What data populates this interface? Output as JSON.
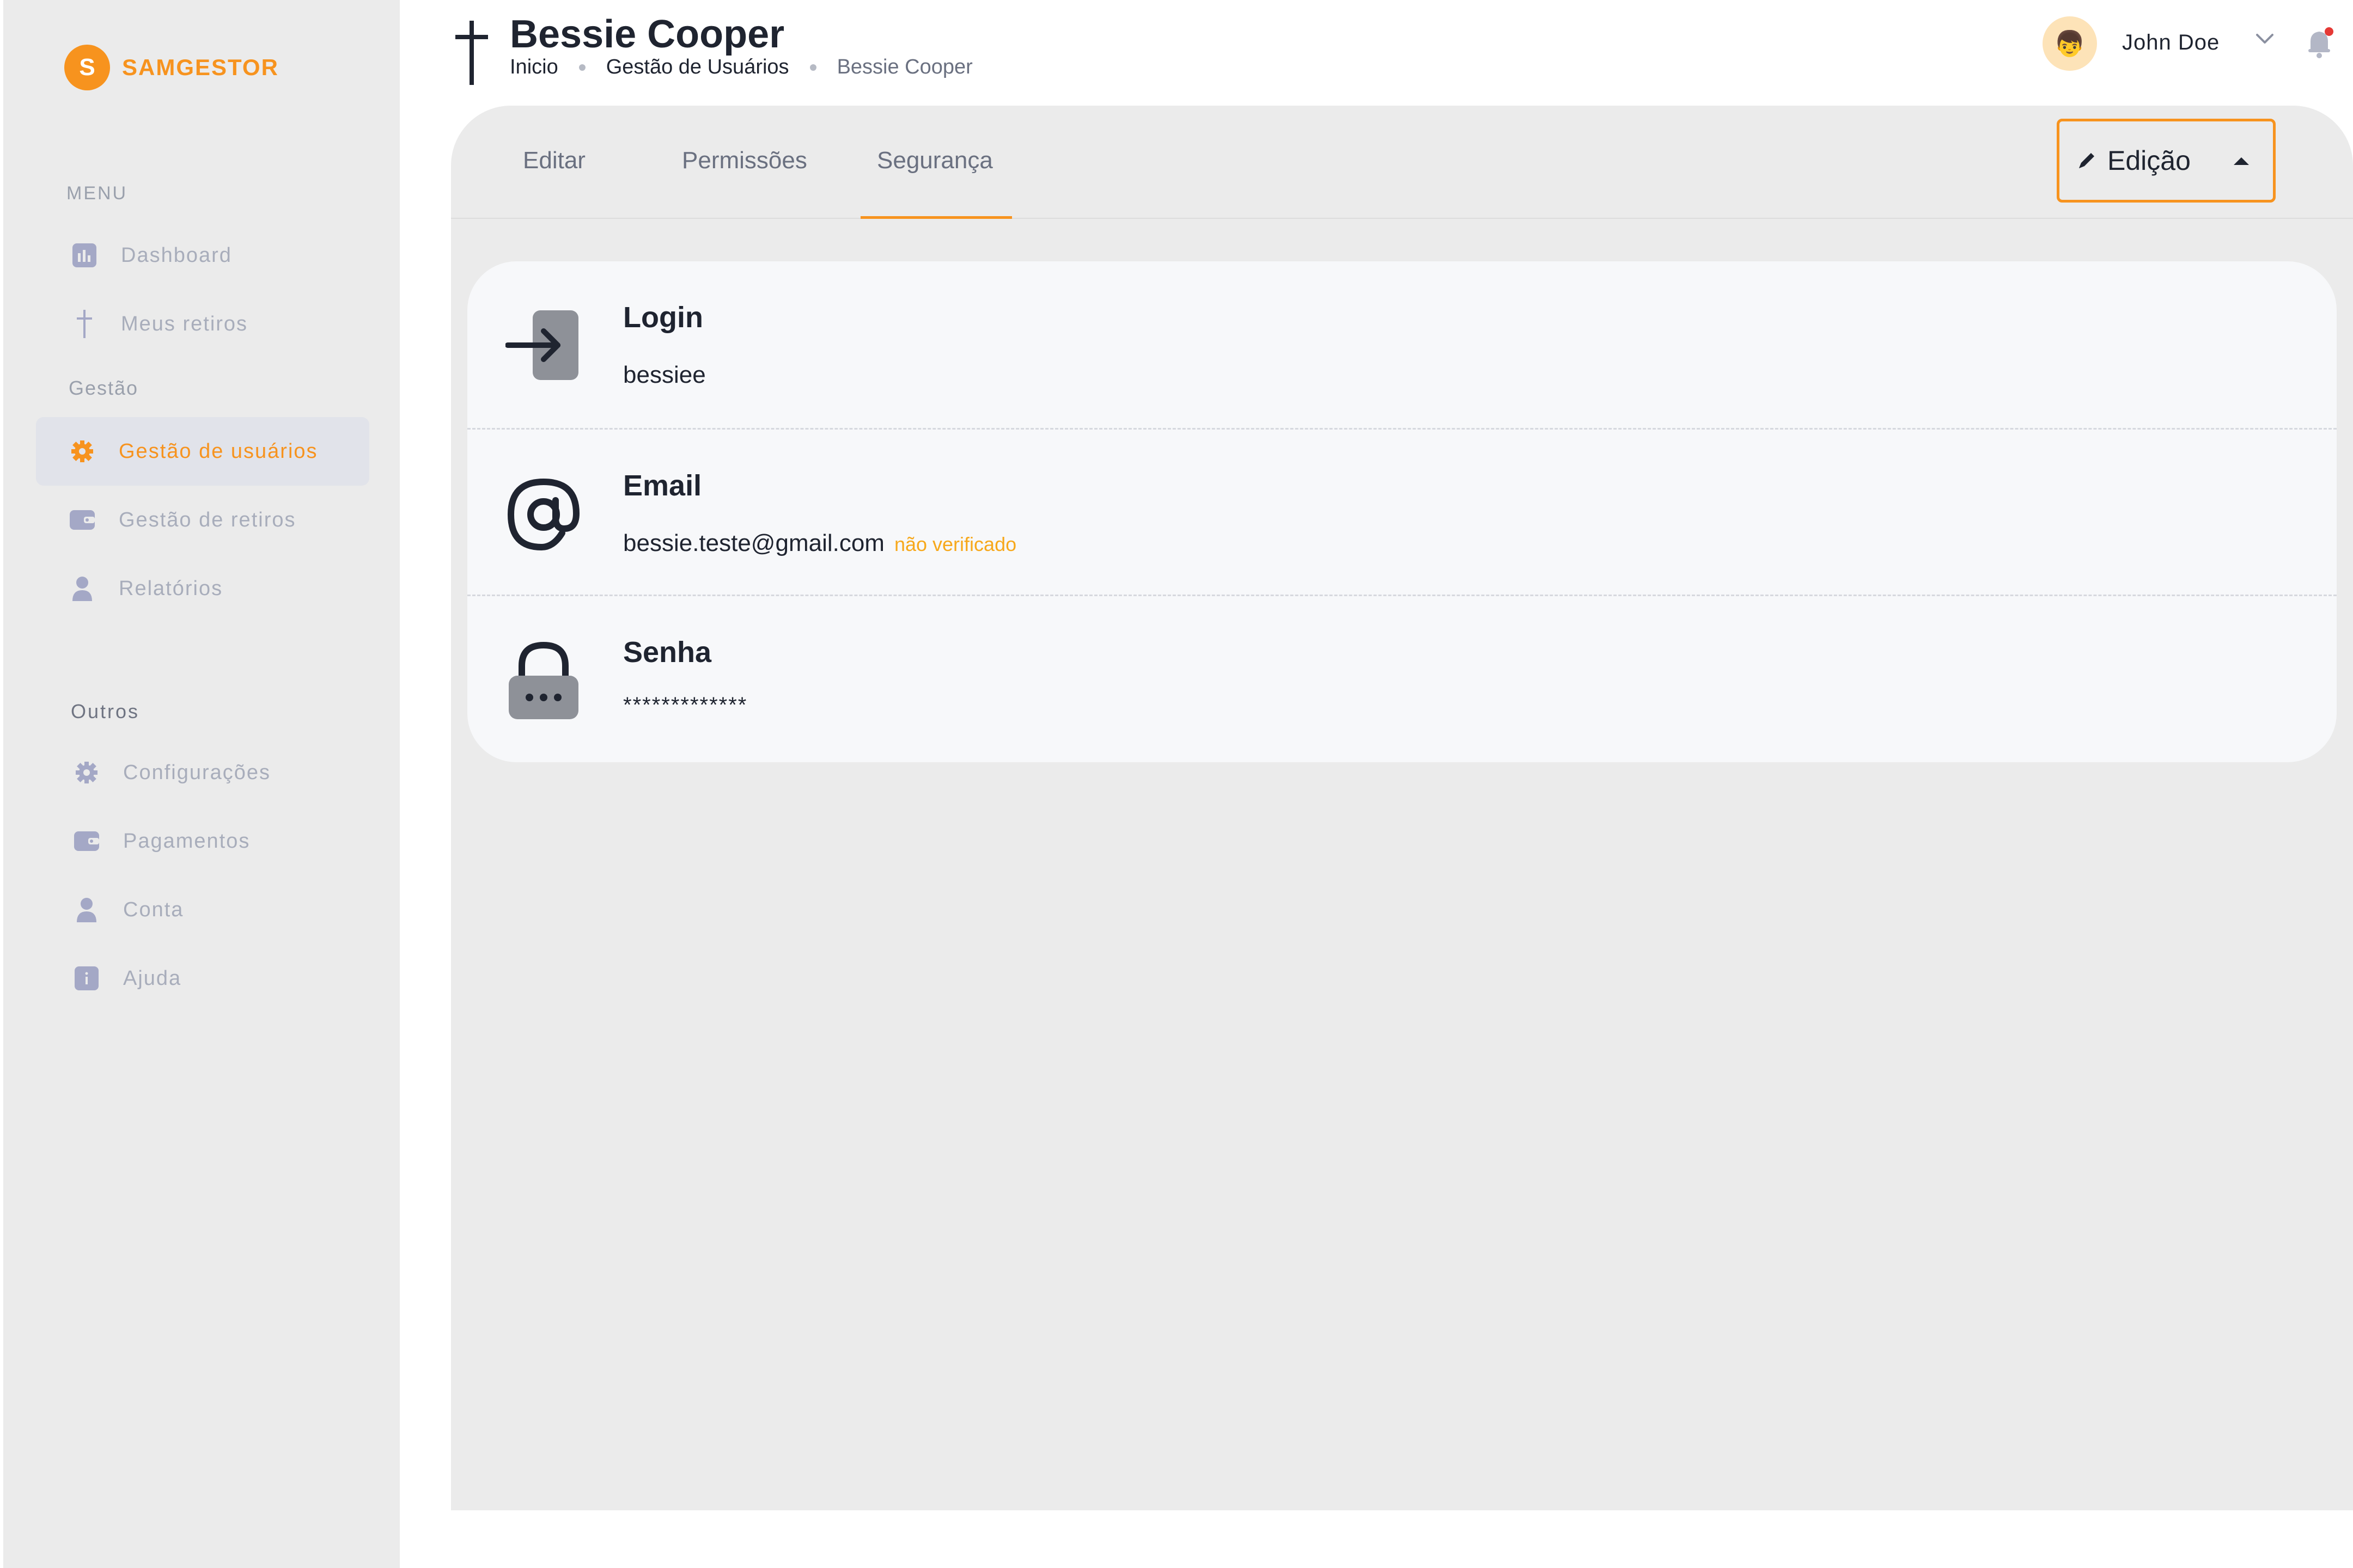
{
  "brand": {
    "logo_letter": "S",
    "name": "SAMGESTOR",
    "accent": "#f7931e"
  },
  "sidebar": {
    "menu_label": "MENU",
    "menu_items": [
      {
        "label": "Dashboard",
        "icon": "dashboard-icon"
      },
      {
        "label": "Meus retiros",
        "icon": "cross-icon"
      }
    ],
    "gestao_label": "Gestão",
    "gestao_items": [
      {
        "label": "Gestão de usuários",
        "icon": "gear-icon",
        "active": true
      },
      {
        "label": "Gestão de retiros",
        "icon": "wallet-icon"
      },
      {
        "label": "Relatórios",
        "icon": "user-icon"
      }
    ],
    "outros_label": "Outros",
    "outros_items": [
      {
        "label": "Configurações",
        "icon": "gear-icon"
      },
      {
        "label": "Pagamentos",
        "icon": "wallet-icon"
      },
      {
        "label": "Conta",
        "icon": "user-icon"
      },
      {
        "label": "Ajuda",
        "icon": "info-icon"
      }
    ]
  },
  "header": {
    "title": "Bessie Cooper",
    "breadcrumb": [
      "Inicio",
      "Gestão de Usuários",
      "Bessie Cooper"
    ],
    "user_name": "John Doe",
    "avatar_glyph": "👦",
    "notification_dot_color": "#e53935"
  },
  "tabs": [
    {
      "label": "Editar",
      "active": false
    },
    {
      "label": "Permissões",
      "active": false
    },
    {
      "label": "Segurança",
      "active": true
    }
  ],
  "mode_button": {
    "label": "Edição",
    "icon": "pencil-icon"
  },
  "security": {
    "login": {
      "title": "Login",
      "value": "bessiee",
      "icon": "login-icon"
    },
    "email": {
      "title": "Email",
      "value": "bessie.teste@gmail.com",
      "status": "não verificado",
      "status_color": "#f7a81b",
      "icon": "at-icon"
    },
    "password": {
      "title": "Senha",
      "value": "*************",
      "icon": "lock-icon"
    }
  }
}
